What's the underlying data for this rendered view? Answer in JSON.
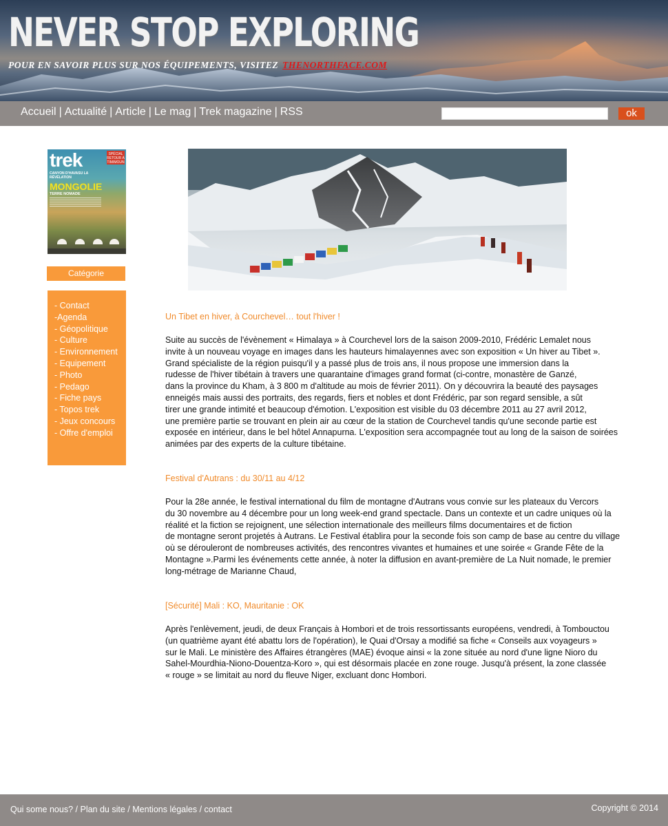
{
  "banner": {
    "headline": "NEVER STOP EXPLORING",
    "tagline": "POUR EN SAVOIR PLUS SUR NOS ÉQUIPEMENTS, VISITEZ",
    "brand_link": "THENORTHFACE.COM"
  },
  "nav": {
    "items": [
      "Accueil",
      "Actualité",
      "Article",
      "Le mag",
      "Trek magazine",
      "RSS"
    ],
    "separator": "|",
    "search_button": "ok"
  },
  "sidebar": {
    "magazine": {
      "logo": "trek",
      "badge": "SPÉCIAL RETOUR À TIMIMOUN",
      "cover_line": "CANYON D'HAVASU LA RÉVÉLATION",
      "title": "MONGOLIE",
      "subtitle": "TERRE NOMADE"
    },
    "category_title": "Catégorie",
    "categories": [
      "- Contact",
      "-Agenda",
      "- Géopolitique",
      "- Culture",
      "- Environnement",
      "- Equipement",
      "- Photo",
      "- Pedago",
      "- Fiche pays",
      "- Topos trek",
      "- Jeux concours",
      "- Offre d'emploi"
    ]
  },
  "articles": [
    {
      "title": "Un Tibet en hiver, à Courchevel… tout l'hiver !",
      "lines": [
        "Suite au succès de l'évènement « Himalaya » à Courchevel lors de la saison 2009-2010, Frédéric Lemalet nous",
        "invite à un nouveau voyage en images dans les hauteurs himalayennes avec son exposition « Un hiver au Tibet ».",
        "Grand spécialiste de la région puisqu'il y a passé plus de trois ans, il nous propose une immersion dans la",
        "rudesse de l'hiver tibétain à travers une quarantaine d'images grand format (ci-contre, monastère de Ganzé,",
        "dans la province du Kham, à 3 800 m d'altitude au mois de février 2011). On y découvrira la beauté des paysages",
        "enneigés mais aussi des portraits, des regards, fiers et nobles et dont Frédéric, par son regard sensible, a sût",
        "tirer une grande intimité et beaucoup d'émotion. L'exposition est visible du 03 décembre 2011 au 27 avril 2012,",
        "une première partie se trouvant en plein air au cœur de la station de Courchevel tandis qu'une seconde partie est",
        "exposée en intérieur, dans le bel hôtel Annapurna. L'exposition sera accompagnée tout au long de la saison de soirées",
        "animées par des experts de la culture tibétaine."
      ]
    },
    {
      "title": "Festival d'Autrans : du 30/11 au 4/12",
      "lines": [
        "Pour la 28e année, le festival international du film de montagne d'Autrans vous convie sur les plateaux du Vercors",
        "du 30 novembre au 4 décembre pour un long week-end grand spectacle. Dans un contexte et un cadre uniques où la",
        "réalité et la fiction se rejoignent, une sélection internationale des meilleurs films documentaires et de fiction",
        "de montagne seront projetés à Autrans. Le Festival établira pour la seconde fois son camp de base au centre du village",
        "où se dérouleront de nombreuses activités, des rencontres vivantes et humaines et une soirée « Grande Fête de la",
        "Montagne ».Parmi les événements cette année, à noter la diffusion en avant-première de La Nuit nomade, le premier",
        "long-métrage de Marianne Chaud,"
      ]
    },
    {
      "title": "[Sécurité] Mali : KO, Mauritanie : OK",
      "lines": [
        "Après l'enlèvement, jeudi, de deux Français à Hombori et de trois ressortissants européens, vendredi, à Tombouctou",
        "(un quatrième ayant été abattu lors de l'opération), le Quai d'Orsay a modifié sa fiche « Conseils aux voyageurs »",
        "sur le Mali. Le ministère des Affaires étrangères (MAE) évoque ainsi « la zone située au nord d'une ligne Nioro du",
        "Sahel-Mourdhia-Niono-Douentza-Koro », qui est désormais placée en zone rouge. Jusqu'à présent, la zone classée",
        "« rouge » se limitait au nord du fleuve Niger, excluant donc Hombori."
      ]
    }
  ],
  "footer": {
    "links": [
      "Qui some nous?",
      "Plan du site",
      "Mentions légales",
      "contact"
    ],
    "separator": "/",
    "copyright": "Copyright © 2014"
  },
  "colors": {
    "accent_orange": "#f99a3a",
    "title_orange": "#f08a2a",
    "bar_gray": "#8f8a88",
    "search_button": "#d9501c",
    "brand_red": "#e01919"
  }
}
